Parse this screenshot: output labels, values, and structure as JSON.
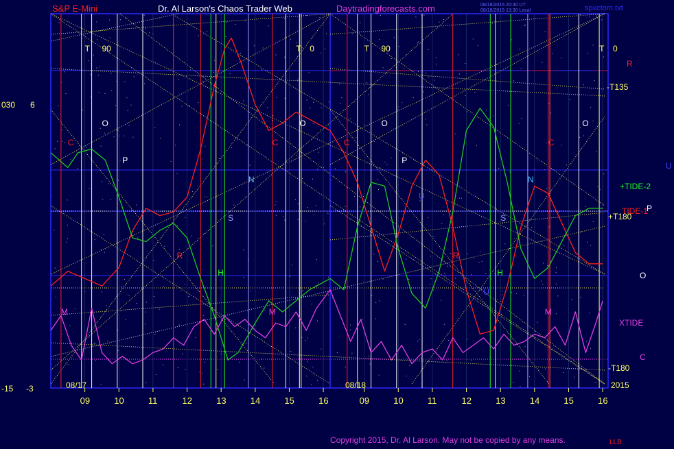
{
  "header": {
    "product": "S&P E-Mini",
    "author": "Dr. Al Larson's Chaos Trader Web",
    "site": "Daytradingforecasts.com",
    "stamp1": "08/18/2015 20:30 UT",
    "stamp2": "08/18/2015 13:30 Local",
    "file": "spxctom.txt"
  },
  "footer": {
    "copyright": "Copyright 2015, Dr. Al Larson. May not be copied by any means.",
    "mark": "LLB"
  },
  "colors": {
    "background": "#000044",
    "frame": "#2a2aff",
    "gann": "#ffff66",
    "cosine": "#ff2020",
    "tide": "#20c820",
    "xtide": "#e040e0",
    "hour_line": "#ffffff"
  },
  "chart_data": {
    "type": "line",
    "title": "S&P E-Mini",
    "y_left_labels": [
      {
        "value": "030",
        "level": 6
      },
      {
        "value": "6",
        "level": 6
      },
      {
        "value": "-15",
        "level": -3
      },
      {
        "value": "-3",
        "level": -3
      }
    ],
    "ylim": [
      -3,
      6
    ],
    "date_labels": [
      "08/17",
      "08/18"
    ],
    "x_ticks": [
      "09",
      "10",
      "11",
      "12",
      "13",
      "14",
      "15",
      "16",
      "09",
      "10",
      "11",
      "12",
      "13",
      "14",
      "15",
      "16"
    ],
    "year_label": "2015",
    "right_labels": [
      {
        "text": "R",
        "color": "#ff2020"
      },
      {
        "text": "-T135",
        "color": "#ffff66"
      },
      {
        "text": "U",
        "color": "#4444ff"
      },
      {
        "text": "+TIDE-2",
        "color": "#20ff20"
      },
      {
        "text": "TIDE-1",
        "color": "#ff2020"
      },
      {
        "text": "P",
        "color": "#ffffff"
      },
      {
        "text": "+T180",
        "color": "#ffff66"
      },
      {
        "text": "O",
        "color": "#ffffff"
      },
      {
        "text": "XTIDE",
        "color": "#e040e0"
      },
      {
        "text": "C",
        "color": "#e040e0"
      },
      {
        "text": "-T180",
        "color": "#ffff66"
      }
    ],
    "markers": [
      {
        "text": "T",
        "color": "#ffff66",
        "day": 1,
        "hour": 9.0
      },
      {
        "text": "90",
        "color": "#ffff66",
        "day": 1,
        "hour": 9.5
      },
      {
        "text": "T",
        "color": "#ffff66",
        "day": 1,
        "hour": 15.2
      },
      {
        "text": "0",
        "color": "#ffff66",
        "day": 1,
        "hour": 15.6
      },
      {
        "text": "T",
        "color": "#ffff66",
        "day": 2,
        "hour": 9.0
      },
      {
        "text": "90",
        "color": "#ffff66",
        "day": 2,
        "hour": 9.5
      },
      {
        "text": "T",
        "color": "#ffff66",
        "day": 2,
        "hour": 15.9
      },
      {
        "text": "0",
        "color": "#ffff66",
        "day": 2,
        "hour": 16.3
      },
      {
        "text": "C",
        "color": "#ff2020",
        "day": 1,
        "hour": 8.5
      },
      {
        "text": "O",
        "color": "#ffffff",
        "day": 1,
        "hour": 9.5
      },
      {
        "text": "P",
        "color": "#ffffff",
        "day": 1,
        "hour": 10.1
      },
      {
        "text": "R",
        "color": "#ff2020",
        "day": 1,
        "hour": 11.7
      },
      {
        "text": "H",
        "color": "#20ff20",
        "day": 1,
        "hour": 12.9
      },
      {
        "text": "S",
        "color": "#a0a0ff",
        "day": 1,
        "hour": 13.2
      },
      {
        "text": "N",
        "color": "#40c0ff",
        "day": 1,
        "hour": 13.8
      },
      {
        "text": "M",
        "color": "#e040e0",
        "day": 1,
        "hour": 8.3
      },
      {
        "text": "C",
        "color": "#ff2020",
        "day": 1,
        "hour": 14.5
      },
      {
        "text": "M",
        "color": "#e040e0",
        "day": 1,
        "hour": 14.4
      },
      {
        "text": "O",
        "color": "#ffffff",
        "day": 1,
        "hour": 15.3
      },
      {
        "text": "C",
        "color": "#ff2020",
        "day": 2,
        "hour": 8.4
      },
      {
        "text": "O",
        "color": "#ffffff",
        "day": 2,
        "hour": 9.5
      },
      {
        "text": "P",
        "color": "#ffffff",
        "day": 2,
        "hour": 10.1
      },
      {
        "text": "U",
        "color": "#4444ff",
        "day": 2,
        "hour": 10.6
      },
      {
        "text": "R",
        "color": "#ff2020",
        "day": 2,
        "hour": 11.6
      },
      {
        "text": "U",
        "color": "#4444ff",
        "day": 2,
        "hour": 12.5
      },
      {
        "text": "H",
        "color": "#20ff20",
        "day": 2,
        "hour": 12.9
      },
      {
        "text": "S",
        "color": "#a0a0ff",
        "day": 2,
        "hour": 13.0
      },
      {
        "text": "N",
        "color": "#40c0ff",
        "day": 2,
        "hour": 13.8
      },
      {
        "text": "C",
        "color": "#ff2020",
        "day": 2,
        "hour": 14.4
      },
      {
        "text": "M",
        "color": "#e040e0",
        "day": 2,
        "hour": 14.3
      },
      {
        "text": "O",
        "color": "#ffffff",
        "day": 2,
        "hour": 15.4
      }
    ],
    "series": [
      {
        "name": "TIDE-1",
        "color": "#ff2020",
        "x": [
          8.0,
          8.5,
          9.0,
          9.5,
          10.0,
          10.4,
          10.8,
          11.2,
          11.6,
          12.0,
          12.4,
          12.8,
          13.1,
          13.3,
          13.6,
          14.0,
          14.4,
          14.8,
          15.2,
          15.6,
          16.0,
          16.4,
          16.8,
          17.2,
          17.6,
          18.0,
          18.4,
          18.8,
          19.2,
          19.6,
          20.0,
          20.4,
          20.8,
          21.2,
          21.6,
          22.0,
          22.4,
          22.8,
          23.2,
          23.6,
          24.0
        ],
        "values": [
          -0.8,
          -0.4,
          -0.6,
          -0.8,
          -0.3,
          0.7,
          1.3,
          1.1,
          1.2,
          1.6,
          2.9,
          4.6,
          5.6,
          5.9,
          5.2,
          4.1,
          3.4,
          3.6,
          3.9,
          3.7,
          3.4,
          2.8,
          2.0,
          0.8,
          -0.4,
          0.6,
          1.9,
          2.6,
          2.2,
          0.8,
          -0.9,
          -2.1,
          -2.0,
          -0.8,
          0.8,
          1.9,
          1.7,
          0.9,
          0.1,
          -0.2,
          -0.2
        ],
        "day_break": 16
      },
      {
        "name": "TIDE-2",
        "color": "#20c820",
        "x": [
          8.0,
          8.5,
          8.8,
          9.2,
          9.6,
          10.0,
          10.4,
          10.8,
          11.2,
          11.6,
          12.0,
          12.4,
          12.8,
          13.2,
          13.5,
          14.0,
          14.4,
          14.8,
          15.2,
          15.6,
          16.0,
          16.4,
          16.8,
          17.2,
          17.6,
          18.0,
          18.4,
          18.8,
          19.2,
          19.6,
          20.0,
          20.4,
          20.8,
          21.2,
          21.6,
          22.0,
          22.4,
          22.8,
          23.2,
          23.6,
          24.0
        ],
        "values": [
          2.8,
          2.4,
          2.8,
          2.9,
          2.6,
          1.6,
          0.5,
          0.4,
          0.7,
          0.9,
          0.5,
          -0.6,
          -1.6,
          -2.8,
          -2.6,
          -1.8,
          -1.2,
          -1.5,
          -1.2,
          -0.9,
          -0.6,
          -0.9,
          0.8,
          2.0,
          1.9,
          0.2,
          -1.0,
          -1.4,
          -0.4,
          1.2,
          3.4,
          4.0,
          3.5,
          2.0,
          0.2,
          -0.6,
          -0.3,
          0.4,
          1.1,
          1.3,
          1.3
        ],
        "day_break": 16
      },
      {
        "name": "XTIDE",
        "color": "#e040e0",
        "x": [
          8.0,
          8.3,
          8.6,
          8.9,
          9.2,
          9.5,
          9.8,
          10.1,
          10.4,
          10.7,
          11.0,
          11.3,
          11.6,
          11.9,
          12.2,
          12.5,
          12.8,
          13.1,
          13.4,
          13.7,
          14.0,
          14.3,
          14.6,
          14.9,
          15.2,
          15.5,
          15.8,
          16.0,
          16.3,
          16.6,
          16.9,
          17.2,
          17.5,
          17.8,
          18.1,
          18.4,
          18.7,
          19.0,
          19.3,
          19.6,
          19.9,
          20.2,
          20.5,
          20.8,
          21.1,
          21.4,
          21.7,
          22.0,
          22.3,
          22.6,
          22.9,
          23.2,
          23.5,
          23.8,
          24.0
        ],
        "values": [
          -2.0,
          -1.6,
          -2.4,
          -2.8,
          -1.4,
          -2.6,
          -2.9,
          -2.7,
          -2.9,
          -2.8,
          -2.6,
          -2.5,
          -2.2,
          -2.4,
          -1.9,
          -1.7,
          -2.1,
          -1.6,
          -1.9,
          -1.7,
          -2.0,
          -2.2,
          -1.8,
          -1.9,
          -1.5,
          -2.0,
          -1.4,
          -0.9,
          -1.6,
          -2.3,
          -1.7,
          -2.6,
          -2.3,
          -2.8,
          -2.4,
          -2.9,
          -2.6,
          -2.5,
          -2.8,
          -2.2,
          -2.6,
          -2.4,
          -2.2,
          -2.5,
          -2.1,
          -2.4,
          -2.3,
          -2.1,
          -2.2,
          -1.9,
          -2.4,
          -1.5,
          -2.6,
          -1.8,
          -1.2
        ],
        "day_break": 16
      }
    ]
  }
}
